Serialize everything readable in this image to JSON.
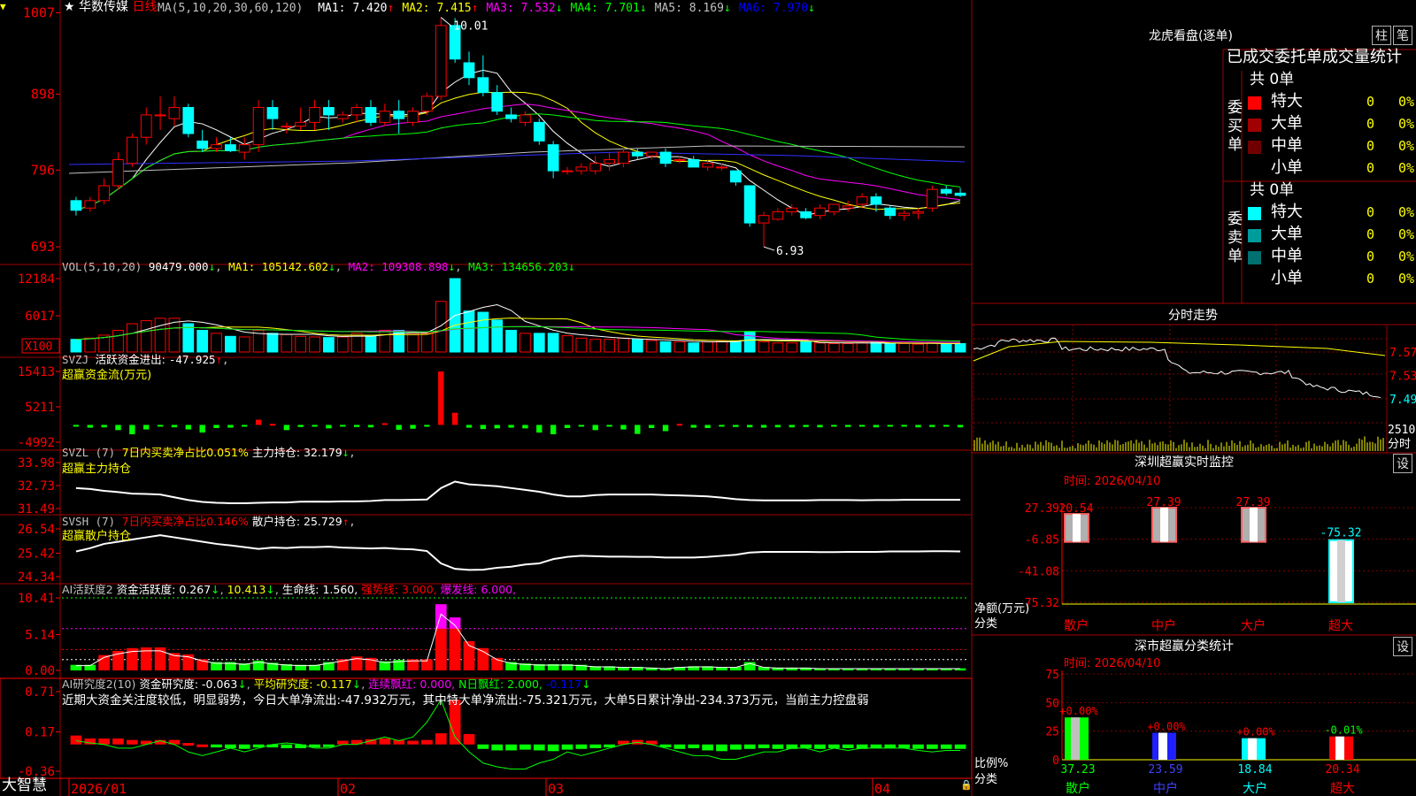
{
  "stock": {
    "star": "★",
    "name": "华数传媒",
    "period": "日线"
  },
  "ma_header": {
    "params": "MA(5,10,20,30,60,120)",
    "items": [
      {
        "label": "MA1: ",
        "value": "7.420",
        "arrow": "↑",
        "color": "#ffffff"
      },
      {
        "label": "MA2: ",
        "value": "7.415",
        "arrow": "↑",
        "color": "#ffff00"
      },
      {
        "label": "MA3: ",
        "value": "7.532",
        "arrow": "↓",
        "color": "#ff00ff"
      },
      {
        "label": "MA4: ",
        "value": "7.701",
        "arrow": "↓",
        "color": "#00ff00"
      },
      {
        "label": "MA5: ",
        "value": "8.169",
        "arrow": "↓",
        "color": "#c0c0c0"
      },
      {
        "label": "MA6: ",
        "value": "7.970",
        "arrow": "↓",
        "color": "#0000ff"
      }
    ]
  },
  "price_axis": {
    "ticks": [
      "1007",
      "898",
      "796",
      "693"
    ],
    "high_label": "10.01",
    "low_label": "6.93"
  },
  "vol_header": {
    "params": "VOL(5,10,20)",
    "value": "90479.000",
    "arrow": "↓",
    "ma1": "MA1: 105142.602",
    "ma2": "MA2: 109308.898",
    "ma3": "MA3: 134656.203"
  },
  "vol_axis": {
    "ticks": [
      "12184",
      "6017"
    ],
    "unit": "X100"
  },
  "svzj": {
    "title": "SVZJ",
    "label": "活跃资金进出: ",
    "value": "-47.925",
    "sub": "超赢资金流(万元)",
    "ticks": [
      "15413",
      "5211",
      "-4992"
    ]
  },
  "svzl": {
    "title": "SVZL (7) ",
    "part1": "7日内买卖净占比0.051% ",
    "part2": "主力持仓: 32.179",
    "sub": "超赢主力持仓",
    "ticks": [
      "33.98",
      "32.73",
      "31.49"
    ]
  },
  "svsh": {
    "title": "SVSH (7) ",
    "part1": "7日内买卖净占比0.146% ",
    "part2": "散户持仓: 25.729",
    "sub": "超赢散户持仓",
    "ticks": [
      "26.54",
      "25.42",
      "24.34"
    ]
  },
  "aihy": {
    "title": "AI活跃度2 ",
    "i1": "资金活跃度: 0.267",
    "i2": "10.413",
    "i3": "生命线: 1.560,",
    "i4": "强势线: 3.000,",
    "i5": "爆发线: 6.000,",
    "ticks": [
      "10.41",
      "5.14",
      "0.00"
    ]
  },
  "aiyj": {
    "title": "AI研究度2(10) ",
    "i1": "资金研究度: -0.063",
    "i2": "平均研究度: -0.117",
    "i3": "连续飘红: 0.000,",
    "i4": "N日飘红: 2.000,",
    "i5": "-0.117",
    "text": "近期大资金关注度较低，明显弱势，今日大单净流出:-47.932万元，其中特大单净流出:-75.321万元，大单5日累计净出-234.373万元，当前主力控盘弱",
    "ticks": [
      "0.71",
      "0.17",
      "-0.36"
    ]
  },
  "date_axis": [
    "2026/01",
    "02",
    "03",
    "04"
  ],
  "brand": "大智慧",
  "lhb": {
    "title": "龙虎看盘(逐单)",
    "btn1": "柱",
    "btn2": "笔",
    "header": "已成交委托单成交量统计",
    "buy": {
      "label": "委买单",
      "total": "共 0单",
      "rows": [
        {
          "name": "特大",
          "qty": "0",
          "pct": "0%",
          "color": "#ff0000"
        },
        {
          "name": "大单",
          "qty": "0",
          "pct": "0%",
          "color": "#a00000"
        },
        {
          "name": "中单",
          "qty": "0",
          "pct": "0%",
          "color": "#700000"
        },
        {
          "name": "小单",
          "qty": "0",
          "pct": "0%",
          "color": "#000000"
        }
      ]
    },
    "sell": {
      "label": "委卖单",
      "total": "共 0单",
      "rows": [
        {
          "name": "特大",
          "qty": "0",
          "pct": "0%",
          "color": "#00ffff"
        },
        {
          "name": "大单",
          "qty": "0",
          "pct": "0%",
          "color": "#009c9c"
        },
        {
          "name": "中单",
          "qty": "0",
          "pct": "0%",
          "color": "#007070"
        },
        {
          "name": "小单",
          "qty": "0",
          "pct": "0%",
          "color": "#000000"
        }
      ]
    }
  },
  "intraday": {
    "title": "分时走势",
    "ticks": [
      "7.57",
      "7.53",
      "7.49"
    ],
    "vol_tick": "2510",
    "vol_unit": "分时"
  },
  "monitor": {
    "title": "深圳超赢实时监控",
    "set": "设",
    "time": "时间: 2026/04/10",
    "ticks": [
      "27.39",
      "-6.85",
      "-41.08",
      "-75.32"
    ],
    "ylabel": "净额(万元)",
    "xlabel": "分类"
  },
  "stats": {
    "title": "深市超赢分类统计",
    "set": "设",
    "time": "时间: 2026/04/10",
    "ticks": [
      "75",
      "50",
      "25",
      "0"
    ],
    "ylabel": "比例%",
    "xlabel": "分类"
  },
  "chart_data": [
    {
      "type": "candlestick",
      "title": "华数传媒 日线",
      "x_range": [
        "2026/01",
        "2026/04/10"
      ],
      "ohlc": [
        [
          7.55,
          7.6,
          7.35,
          7.42
        ],
        [
          7.45,
          7.6,
          7.4,
          7.55
        ],
        [
          7.55,
          7.85,
          7.5,
          7.75
        ],
        [
          7.75,
          8.2,
          7.7,
          8.1
        ],
        [
          8.05,
          8.45,
          8.0,
          8.4
        ],
        [
          8.4,
          8.8,
          8.3,
          8.7
        ],
        [
          8.7,
          8.95,
          8.5,
          8.7
        ],
        [
          8.65,
          8.95,
          8.55,
          8.8
        ],
        [
          8.8,
          8.85,
          8.4,
          8.45
        ],
        [
          8.35,
          8.5,
          8.2,
          8.25
        ],
        [
          8.25,
          8.4,
          8.2,
          8.3
        ],
        [
          8.3,
          8.4,
          8.2,
          8.22
        ],
        [
          8.2,
          8.4,
          8.1,
          8.3
        ],
        [
          8.3,
          8.9,
          8.2,
          8.8
        ],
        [
          8.8,
          8.9,
          8.5,
          8.65
        ],
        [
          8.55,
          8.6,
          8.45,
          8.55
        ],
        [
          8.55,
          8.8,
          8.5,
          8.6
        ],
        [
          8.6,
          8.9,
          8.5,
          8.8
        ],
        [
          8.8,
          8.9,
          8.5,
          8.7
        ],
        [
          8.65,
          8.75,
          8.6,
          8.7
        ],
        [
          8.7,
          8.85,
          8.6,
          8.8
        ],
        [
          8.8,
          8.9,
          8.55,
          8.6
        ],
        [
          8.6,
          8.85,
          8.55,
          8.75
        ],
        [
          8.75,
          8.9,
          8.45,
          8.65
        ],
        [
          8.6,
          8.8,
          8.55,
          8.75
        ],
        [
          8.75,
          9.0,
          8.7,
          8.95
        ],
        [
          8.95,
          10.01,
          8.9,
          9.9
        ],
        [
          9.9,
          10.0,
          9.4,
          9.45
        ],
        [
          9.4,
          9.55,
          9.1,
          9.2
        ],
        [
          9.2,
          9.5,
          8.95,
          9.0
        ],
        [
          9.0,
          9.1,
          8.7,
          8.75
        ],
        [
          8.7,
          8.8,
          8.6,
          8.65
        ],
        [
          8.6,
          8.75,
          8.55,
          8.7
        ],
        [
          8.6,
          8.65,
          8.3,
          8.35
        ],
        [
          8.3,
          8.35,
          7.85,
          7.95
        ],
        [
          7.95,
          8.0,
          7.9,
          7.95
        ],
        [
          7.95,
          8.05,
          7.9,
          8.0
        ],
        [
          7.95,
          8.15,
          7.9,
          8.05
        ],
        [
          8.05,
          8.2,
          7.95,
          8.1
        ],
        [
          8.05,
          8.25,
          8.0,
          8.2
        ],
        [
          8.2,
          8.25,
          8.1,
          8.15
        ],
        [
          8.15,
          8.2,
          8.1,
          8.2
        ],
        [
          8.2,
          8.25,
          8.0,
          8.05
        ],
        [
          8.1,
          8.15,
          8.05,
          8.1
        ],
        [
          8.1,
          8.15,
          8.0,
          8.0
        ],
        [
          8.0,
          8.1,
          7.95,
          8.05
        ],
        [
          8.0,
          8.05,
          7.95,
          8.0
        ],
        [
          7.95,
          7.95,
          7.75,
          7.8
        ],
        [
          7.75,
          7.75,
          7.2,
          7.25
        ],
        [
          7.25,
          7.4,
          6.93,
          7.35
        ],
        [
          7.3,
          7.45,
          7.28,
          7.4
        ],
        [
          7.4,
          7.5,
          7.35,
          7.45
        ],
        [
          7.4,
          7.45,
          7.3,
          7.32
        ],
        [
          7.35,
          7.5,
          7.3,
          7.45
        ],
        [
          7.4,
          7.5,
          7.35,
          7.5
        ],
        [
          7.45,
          7.55,
          7.4,
          7.48
        ],
        [
          7.5,
          7.65,
          7.45,
          7.6
        ],
        [
          7.6,
          7.65,
          7.4,
          7.5
        ],
        [
          7.45,
          7.48,
          7.3,
          7.35
        ],
        [
          7.35,
          7.42,
          7.28,
          7.38
        ],
        [
          7.38,
          7.45,
          7.3,
          7.4
        ],
        [
          7.45,
          7.75,
          7.4,
          7.7
        ],
        [
          7.7,
          7.75,
          7.62,
          7.65
        ],
        [
          7.65,
          7.72,
          7.6,
          7.62
        ]
      ],
      "ylim": [
        6.8,
        10.1
      ]
    },
    {
      "type": "bar",
      "title": "VOL(5,10,20)",
      "unit": "X100",
      "values": [
        2100,
        2300,
        2800,
        3600,
        4700,
        5200,
        5600,
        5600,
        4700,
        3600,
        3100,
        2600,
        2500,
        3600,
        3100,
        2900,
        2600,
        2500,
        2400,
        2500,
        3100,
        2600,
        3600,
        3600,
        3100,
        3100,
        8400,
        12184,
        6800,
        6600,
        5300,
        3600,
        3100,
        3100,
        3100,
        2700,
        2300,
        2100,
        2100,
        2300,
        2100,
        1900,
        1700,
        1700,
        1500,
        1700,
        1800,
        1800,
        3300,
        1700,
        1500,
        1500,
        1700,
        1500,
        1400,
        1400,
        1500,
        1600,
        1400,
        1400,
        1300,
        1500,
        1400,
        1400
      ],
      "ylim": [
        0,
        12184
      ]
    },
    {
      "type": "bar",
      "title": "超赢资金流(万元)",
      "values": [
        -500,
        -800,
        -700,
        -1500,
        -2700,
        -1300,
        -400,
        -700,
        -1300,
        -2200,
        -900,
        -800,
        -200,
        1500,
        300,
        -1500,
        -600,
        -500,
        -1000,
        -200,
        -600,
        -700,
        500,
        -1400,
        -1100,
        -300,
        15413,
        3500,
        -800,
        -1200,
        -1000,
        -800,
        -1000,
        -2200,
        -2700,
        -900,
        -500,
        -1500,
        -300,
        -1300,
        -2600,
        -900,
        -1800,
        300,
        -800,
        -900,
        -400,
        -600,
        -700,
        -800,
        -700,
        -700,
        -600,
        -700,
        -500,
        -600,
        -500,
        -700,
        -400,
        -500,
        -700,
        -600,
        -500,
        -700
      ],
      "ylim": [
        -4992,
        15413
      ]
    },
    {
      "type": "line",
      "title": "超赢主力持仓",
      "ylim": [
        31.49,
        33.98
      ]
    },
    {
      "type": "line",
      "title": "超赢散户持仓",
      "ylim": [
        24.34,
        26.54
      ]
    },
    {
      "type": "bar",
      "title": "AI活跃度2",
      "values": [
        0.8,
        0.8,
        2.2,
        2.8,
        3.2,
        3.3,
        3.3,
        2.5,
        2.3,
        1.6,
        1.2,
        1.2,
        1.0,
        1.4,
        1.1,
        0.9,
        0.8,
        0.8,
        1.2,
        1.6,
        2.0,
        1.8,
        1.3,
        1.5,
        1.6,
        1.6,
        9.5,
        7.6,
        4.2,
        3.2,
        1.8,
        1.2,
        1.0,
        0.9,
        0.9,
        0.9,
        0.8,
        0.6,
        0.6,
        0.5,
        0.5,
        0.4,
        0.3,
        0.5,
        0.6,
        0.6,
        0.5,
        0.5,
        1.2,
        0.5,
        0.4,
        0.4,
        0.4,
        0.3,
        0.3,
        0.3,
        0.3,
        0.3,
        0.3,
        0.3,
        0.3,
        0.3,
        0.3,
        0.3
      ],
      "ylim": [
        0,
        10.41
      ]
    },
    {
      "type": "bar",
      "title": "AI研究度2(10)",
      "values": [
        0.12,
        0.08,
        0.08,
        0.08,
        0.06,
        0.05,
        0.06,
        0.06,
        0.02,
        0.0,
        -0.04,
        -0.05,
        -0.06,
        -0.04,
        -0.04,
        -0.05,
        -0.05,
        -0.04,
        -0.02,
        0.05,
        0.06,
        0.07,
        0.08,
        0.06,
        0.05,
        0.06,
        0.15,
        0.6,
        0.14,
        -0.06,
        -0.08,
        -0.08,
        -0.07,
        -0.08,
        -0.09,
        -0.07,
        -0.06,
        -0.05,
        -0.04,
        0.05,
        0.06,
        0.05,
        -0.04,
        -0.06,
        -0.05,
        -0.08,
        -0.09,
        -0.07,
        -0.06,
        -0.05,
        -0.06,
        -0.06,
        -0.05,
        -0.06,
        -0.05,
        -0.05,
        -0.06,
        -0.05,
        -0.05,
        -0.05,
        -0.06,
        -0.06,
        -0.06,
        -0.06
      ],
      "ylim": [
        -0.36,
        0.71
      ]
    },
    {
      "type": "bar",
      "title": "深圳超赢实时监控",
      "categories": [
        "散户",
        "中户",
        "大户",
        "超大"
      ],
      "values": [
        20.54,
        27.39,
        27.39,
        -75.32
      ],
      "ylim": [
        -75.32,
        27.39
      ]
    },
    {
      "type": "bar",
      "title": "深市超赢分类统计",
      "categories": [
        "散户",
        "中户",
        "大户",
        "超大"
      ],
      "values": [
        37.23,
        23.59,
        18.84,
        20.34
      ],
      "changes": [
        "+0.00%",
        "+0.00%",
        "+0.00%",
        "-0.01%"
      ],
      "ylim": [
        0,
        75
      ]
    }
  ]
}
